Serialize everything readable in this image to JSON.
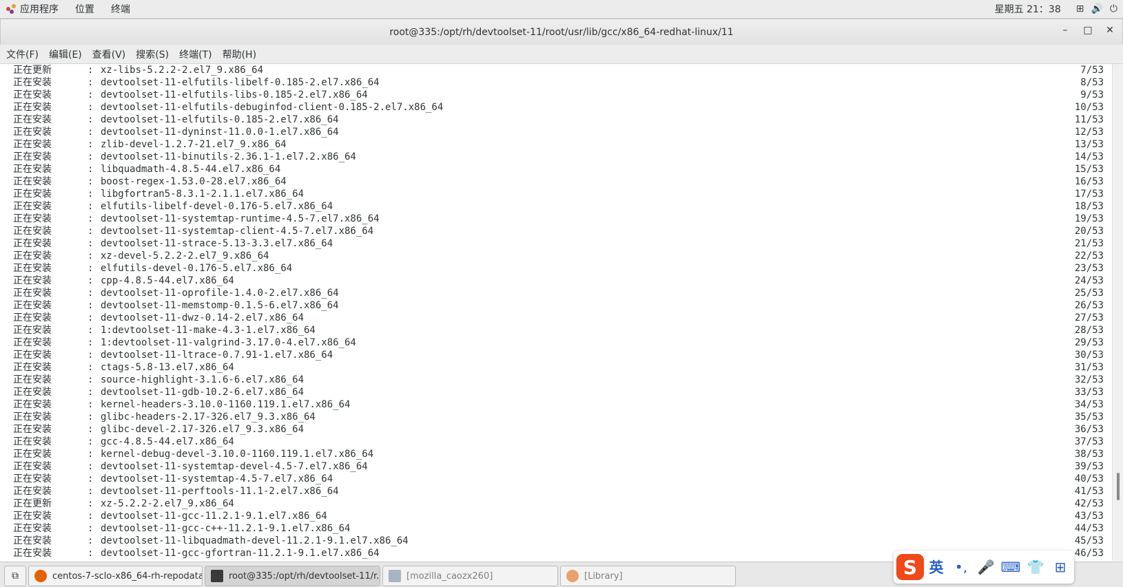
{
  "topbar": {
    "applications": "应用程序",
    "places": "位置",
    "terminal": "终端",
    "clock": "星期五 21：38",
    "tray": [
      {
        "icon": "network-icon",
        "glyph": "⊞"
      },
      {
        "icon": "volume-icon",
        "glyph": "🔊"
      },
      {
        "icon": "power-icon",
        "glyph": "⏻"
      }
    ]
  },
  "window": {
    "title": "root@335:/opt/rh/devtoolset-11/root/usr/lib/gcc/x86_64-redhat-linux/11",
    "min": "–",
    "max": "□",
    "close": "✕"
  },
  "menubar": [
    "文件(F)",
    "编辑(E)",
    "查看(V)",
    "搜索(S)",
    "终端(T)",
    "帮助(H)"
  ],
  "terminal": {
    "lines": [
      {
        "status": "正在更新",
        "pkg": "xz-libs-5.2.2-2.el7_9.x86_64",
        "num": "7/53"
      },
      {
        "status": "正在安装",
        "pkg": "devtoolset-11-elfutils-libelf-0.185-2.el7.x86_64",
        "num": "8/53"
      },
      {
        "status": "正在安装",
        "pkg": "devtoolset-11-elfutils-libs-0.185-2.el7.x86_64",
        "num": "9/53"
      },
      {
        "status": "正在安装",
        "pkg": "devtoolset-11-elfutils-debuginfod-client-0.185-2.el7.x86_64",
        "num": "10/53"
      },
      {
        "status": "正在安装",
        "pkg": "devtoolset-11-elfutils-0.185-2.el7.x86_64",
        "num": "11/53"
      },
      {
        "status": "正在安装",
        "pkg": "devtoolset-11-dyninst-11.0.0-1.el7.x86_64",
        "num": "12/53"
      },
      {
        "status": "正在安装",
        "pkg": "zlib-devel-1.2.7-21.el7_9.x86_64",
        "num": "13/53"
      },
      {
        "status": "正在安装",
        "pkg": "devtoolset-11-binutils-2.36.1-1.el7.2.x86_64",
        "num": "14/53"
      },
      {
        "status": "正在安装",
        "pkg": "libquadmath-4.8.5-44.el7.x86_64",
        "num": "15/53"
      },
      {
        "status": "正在安装",
        "pkg": "boost-regex-1.53.0-28.el7.x86_64",
        "num": "16/53"
      },
      {
        "status": "正在安装",
        "pkg": "libgfortran5-8.3.1-2.1.1.el7.x86_64",
        "num": "17/53"
      },
      {
        "status": "正在安装",
        "pkg": "elfutils-libelf-devel-0.176-5.el7.x86_64",
        "num": "18/53"
      },
      {
        "status": "正在安装",
        "pkg": "devtoolset-11-systemtap-runtime-4.5-7.el7.x86_64",
        "num": "19/53"
      },
      {
        "status": "正在安装",
        "pkg": "devtoolset-11-systemtap-client-4.5-7.el7.x86_64",
        "num": "20/53"
      },
      {
        "status": "正在安装",
        "pkg": "devtoolset-11-strace-5.13-3.3.el7.x86_64",
        "num": "21/53"
      },
      {
        "status": "正在安装",
        "pkg": "xz-devel-5.2.2-2.el7_9.x86_64",
        "num": "22/53"
      },
      {
        "status": "正在安装",
        "pkg": "elfutils-devel-0.176-5.el7.x86_64",
        "num": "23/53"
      },
      {
        "status": "正在安装",
        "pkg": "cpp-4.8.5-44.el7.x86_64",
        "num": "24/53"
      },
      {
        "status": "正在安装",
        "pkg": "devtoolset-11-oprofile-1.4.0-2.el7.x86_64",
        "num": "25/53"
      },
      {
        "status": "正在安装",
        "pkg": "devtoolset-11-memstomp-0.1.5-6.el7.x86_64",
        "num": "26/53"
      },
      {
        "status": "正在安装",
        "pkg": "devtoolset-11-dwz-0.14-2.el7.x86_64",
        "num": "27/53"
      },
      {
        "status": "正在安装",
        "pkg": "1:devtoolset-11-make-4.3-1.el7.x86_64",
        "num": "28/53"
      },
      {
        "status": "正在安装",
        "pkg": "1:devtoolset-11-valgrind-3.17.0-4.el7.x86_64",
        "num": "29/53"
      },
      {
        "status": "正在安装",
        "pkg": "devtoolset-11-ltrace-0.7.91-1.el7.x86_64",
        "num": "30/53"
      },
      {
        "status": "正在安装",
        "pkg": "ctags-5.8-13.el7.x86_64",
        "num": "31/53"
      },
      {
        "status": "正在安装",
        "pkg": "source-highlight-3.1.6-6.el7.x86_64",
        "num": "32/53"
      },
      {
        "status": "正在安装",
        "pkg": "devtoolset-11-gdb-10.2-6.el7.x86_64",
        "num": "33/53"
      },
      {
        "status": "正在安装",
        "pkg": "kernel-headers-3.10.0-1160.119.1.el7.x86_64",
        "num": "34/53"
      },
      {
        "status": "正在安装",
        "pkg": "glibc-headers-2.17-326.el7_9.3.x86_64",
        "num": "35/53"
      },
      {
        "status": "正在安装",
        "pkg": "glibc-devel-2.17-326.el7_9.3.x86_64",
        "num": "36/53"
      },
      {
        "status": "正在安装",
        "pkg": "gcc-4.8.5-44.el7.x86_64",
        "num": "37/53"
      },
      {
        "status": "正在安装",
        "pkg": "kernel-debug-devel-3.10.0-1160.119.1.el7.x86_64",
        "num": "38/53"
      },
      {
        "status": "正在安装",
        "pkg": "devtoolset-11-systemtap-devel-4.5-7.el7.x86_64",
        "num": "39/53"
      },
      {
        "status": "正在安装",
        "pkg": "devtoolset-11-systemtap-4.5-7.el7.x86_64",
        "num": "40/53"
      },
      {
        "status": "正在安装",
        "pkg": "devtoolset-11-perftools-11.1-2.el7.x86_64",
        "num": "41/53"
      },
      {
        "status": "正在更新",
        "pkg": "xz-5.2.2-2.el7_9.x86_64",
        "num": "42/53"
      },
      {
        "status": "正在安装",
        "pkg": "devtoolset-11-gcc-11.2.1-9.1.el7.x86_64",
        "num": "43/53"
      },
      {
        "status": "正在安装",
        "pkg": "devtoolset-11-gcc-c++-11.2.1-9.1.el7.x86_64",
        "num": "44/53"
      },
      {
        "status": "正在安装",
        "pkg": "devtoolset-11-libquadmath-devel-11.2.1-9.1.el7.x86_64",
        "num": "45/53"
      },
      {
        "status": "正在安装",
        "pkg": "devtoolset-11-gcc-gfortran-11.2.1-9.1.el7.x86_64",
        "num": "46/53"
      }
    ]
  },
  "taskbar": {
    "items": [
      {
        "label": "centos-7-sclo-x86_64-rh-repodata...",
        "icon": "firefox-icon",
        "color": "#e66000"
      },
      {
        "label": "root@335:/opt/rh/devtoolset-11/r...",
        "icon": "terminal-icon",
        "color": "#3a3a3a"
      },
      {
        "label": "[mozilla_caozx260]",
        "icon": "file-manager-icon",
        "color": "#a9b4c2"
      },
      {
        "label": "[Library]",
        "icon": "firefox-icon",
        "color": "#e8a070"
      }
    ]
  },
  "ime": {
    "logo": "S",
    "lang": "英",
    "punct": "•,",
    "voice": "🎤",
    "keyboard": "⌨",
    "skin": "👕",
    "tools": "⊞"
  }
}
